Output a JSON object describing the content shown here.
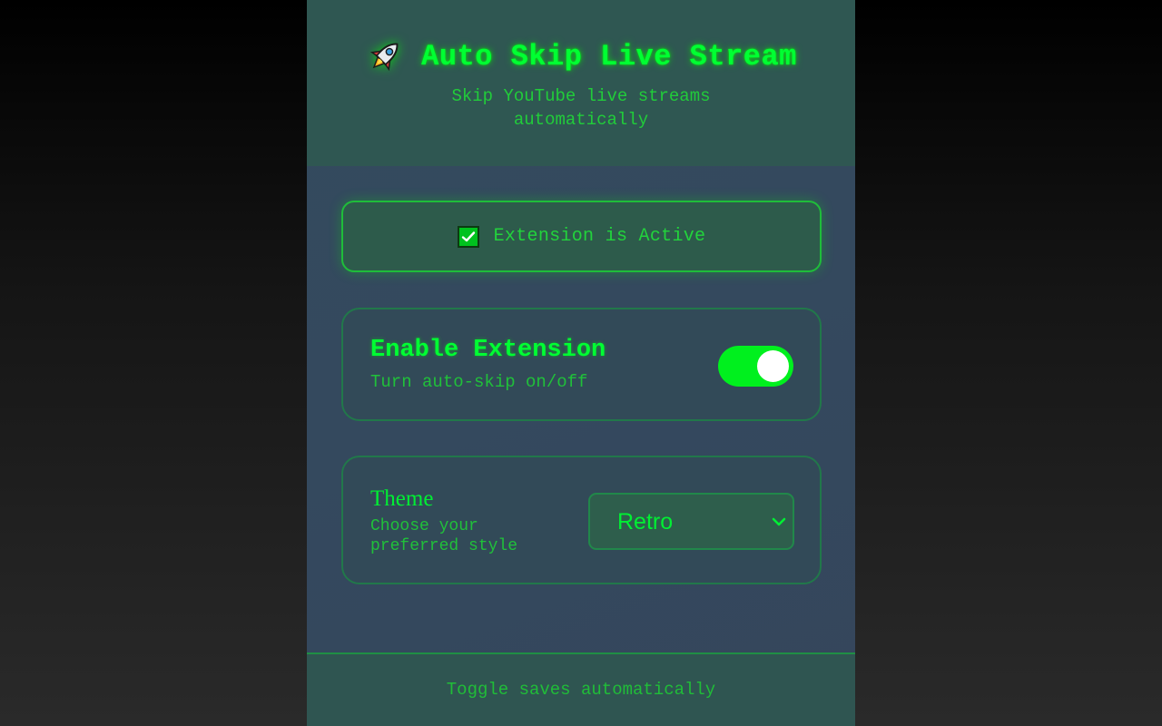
{
  "header": {
    "icon": "rocket-icon",
    "title": "Auto Skip Live Stream",
    "subtitle": "Skip YouTube live streams automatically"
  },
  "status": {
    "icon": "checkbox-checked-icon",
    "text": "Extension is Active"
  },
  "enable_card": {
    "title": "Enable Extension",
    "description": "Turn auto-skip on/off",
    "toggle_on": true
  },
  "theme_card": {
    "title": "Theme",
    "description": "Choose your preferred style",
    "selected": "Retro",
    "dropdown_icon": "chevron-down-icon"
  },
  "footer": {
    "text": "Toggle saves automatically"
  },
  "colors": {
    "accent": "#00ff33",
    "header_bg": "#2f5752",
    "panel_bg": "#34495e"
  }
}
